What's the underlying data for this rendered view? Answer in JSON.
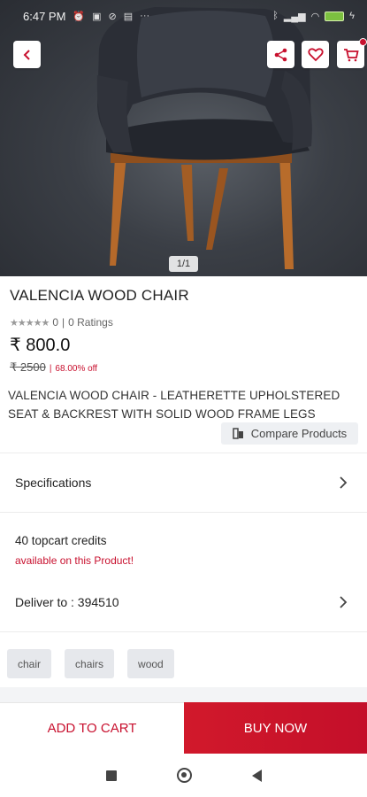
{
  "status_bar": {
    "time": "6:47 PM",
    "left_icons": [
      "alarm-icon",
      "sim-icon",
      "mute-icon",
      "notification-icon",
      "more-dots-icon"
    ],
    "right_icons": [
      "bluetooth-icon",
      "signal-icon",
      "wifi-icon",
      "battery-icon",
      "charging-icon"
    ],
    "more_dots": "···"
  },
  "header": {
    "back_icon": "chevron-left-icon",
    "share_icon": "share-icon",
    "wishlist_icon": "heart-icon",
    "cart_icon": "cart-icon"
  },
  "gallery": {
    "counter": "1/1"
  },
  "product": {
    "title": "VALENCIA WOOD CHAIR",
    "rating_value": "0",
    "rating_separator": "|",
    "ratings_count": "0 Ratings",
    "price": "₹ 800.0",
    "mrp": "₹ 2500",
    "discount_separator": "|",
    "discount": "68.00% off",
    "description": "VALENCIA WOOD CHAIR - LEATHERETTE UPHOLSTERED SEAT & BACKREST WITH SOLID WOOD FRAME LEGS",
    "compare_label": "Compare Products"
  },
  "sections": {
    "specifications_label": "Specifications",
    "credits_title": "40 topcart credits",
    "credits_subtitle": "available on this Product!",
    "deliver_label": "Deliver to : 394510"
  },
  "tags": [
    "chair",
    "chairs",
    "wood"
  ],
  "actions": {
    "add_to_cart": "ADD TO CART",
    "buy_now": "BUY NOW"
  },
  "colors": {
    "accent": "#c8102e",
    "buy_now_bg": "#d1192b",
    "tag_bg": "#e6e8ec"
  }
}
